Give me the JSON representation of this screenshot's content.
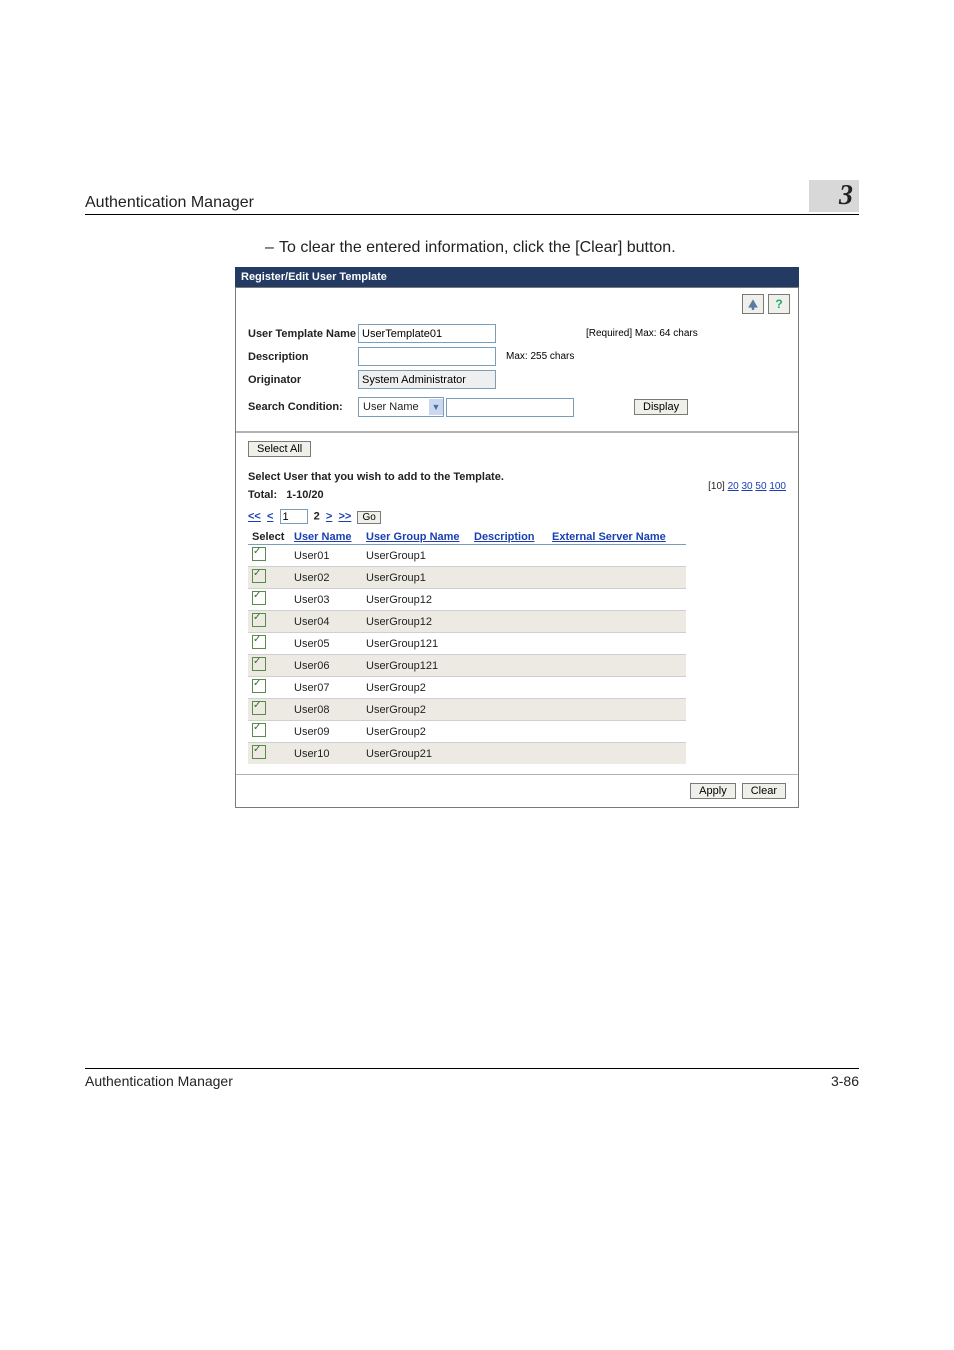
{
  "header": {
    "left": "Authentication Manager",
    "chapter": "3"
  },
  "bullet": {
    "text": "To clear the entered information, click the [Clear] button."
  },
  "panel": {
    "title": "Register/Edit User Template",
    "form": {
      "templateName": {
        "label": "User Template Name",
        "value": "UserTemplate01",
        "hint": "[Required] Max: 64 chars"
      },
      "description": {
        "label": "Description",
        "value": "",
        "hint": "Max: 255 chars"
      },
      "originator": {
        "label": "Originator",
        "value": "System Administrator"
      },
      "search": {
        "label": "Search Condition:",
        "selected": "User Name",
        "input": "",
        "buttonLabel": "Display"
      }
    },
    "selectAllLabel": "Select All",
    "subtitle": "Select User that you wish to add to the Template.",
    "totalLabel": "Total:",
    "totalRange": "1-10/20",
    "pageSizes": {
      "active": "[10]",
      "options": [
        "20",
        "30",
        "50",
        "100"
      ]
    },
    "pager": {
      "first": "<<",
      "prev": "<",
      "pageValue": "1",
      "next": "2",
      "nextSym": ">",
      "last": ">>",
      "goLabel": "Go"
    },
    "columns": [
      "Select",
      "User Name",
      "User Group Name",
      "Description",
      "External Server Name"
    ],
    "rows": [
      {
        "user": "User01",
        "group": "UserGroup1"
      },
      {
        "user": "User02",
        "group": "UserGroup1"
      },
      {
        "user": "User03",
        "group": "UserGroup12"
      },
      {
        "user": "User04",
        "group": "UserGroup12"
      },
      {
        "user": "User05",
        "group": "UserGroup121"
      },
      {
        "user": "User06",
        "group": "UserGroup121"
      },
      {
        "user": "User07",
        "group": "UserGroup2"
      },
      {
        "user": "User08",
        "group": "UserGroup2"
      },
      {
        "user": "User09",
        "group": "UserGroup2"
      },
      {
        "user": "User10",
        "group": "UserGroup21"
      }
    ],
    "buttons": {
      "apply": "Apply",
      "clear": "Clear"
    },
    "helpGlyph": "?"
  },
  "footer": {
    "left": "Authentication Manager",
    "right": "3-86"
  }
}
